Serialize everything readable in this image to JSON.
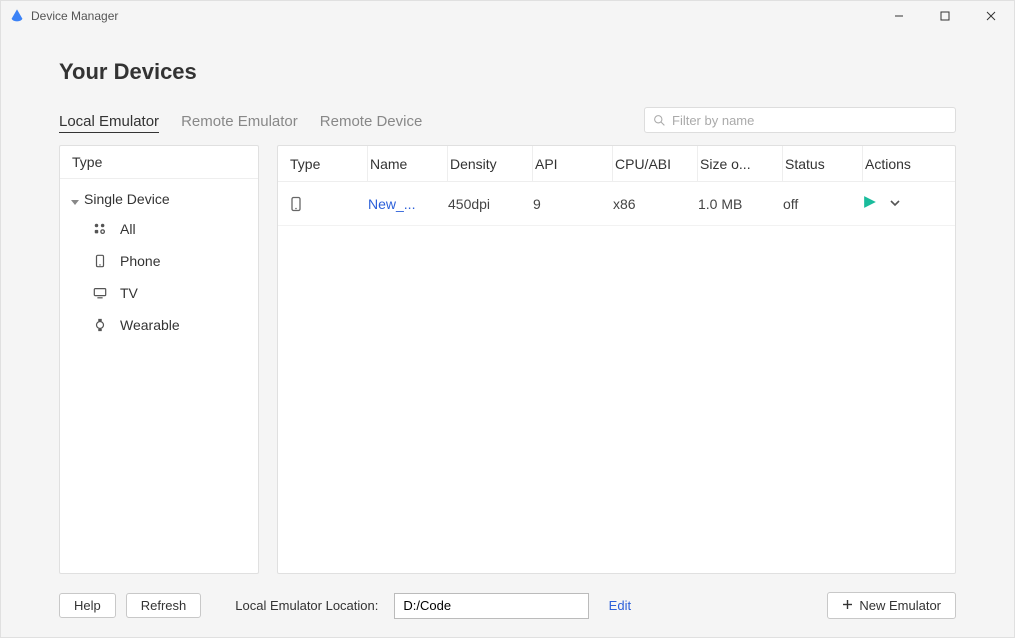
{
  "window": {
    "title": "Device Manager"
  },
  "page": {
    "heading": "Your Devices"
  },
  "tabs": {
    "local": "Local Emulator",
    "remote_emulator": "Remote Emulator",
    "remote_device": "Remote Device"
  },
  "search": {
    "placeholder": "Filter by name"
  },
  "sidebar": {
    "header": "Type",
    "group": "Single Device",
    "items": {
      "all": "All",
      "phone": "Phone",
      "tv": "TV",
      "wearable": "Wearable"
    }
  },
  "table": {
    "columns": {
      "type": "Type",
      "name": "Name",
      "density": "Density",
      "api": "API",
      "cpu": "CPU/ABI",
      "size": "Size o...",
      "status": "Status",
      "actions": "Actions"
    },
    "row0": {
      "name": "New_...",
      "density": "450dpi",
      "api": "9",
      "cpu": "x86",
      "size": "1.0 MB",
      "status": "off"
    }
  },
  "footer": {
    "help": "Help",
    "refresh": "Refresh",
    "location_label": "Local Emulator Location:",
    "location_value": "D:/Code",
    "edit": "Edit",
    "new_emulator": "New Emulator"
  }
}
